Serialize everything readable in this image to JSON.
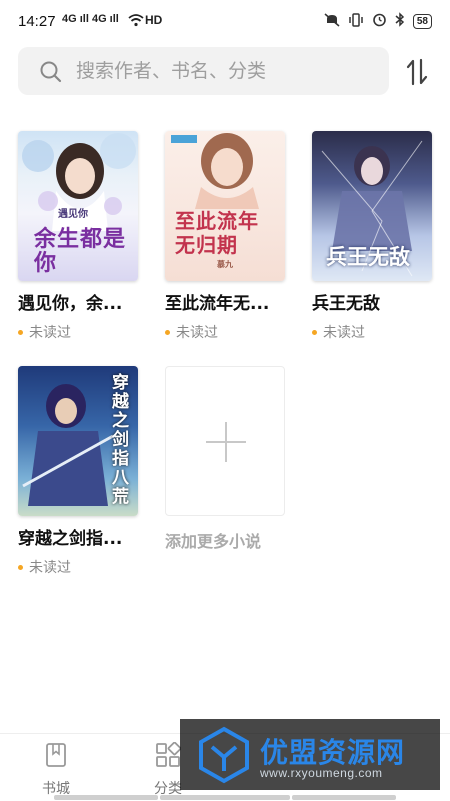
{
  "statusbar": {
    "time": "14:27",
    "signal_text": "4G ıll 4G ıll",
    "network": "HD",
    "battery": "58"
  },
  "search": {
    "placeholder": "搜索作者、书名、分类"
  },
  "shelf": {
    "books": [
      {
        "title": "遇见你，余...",
        "status": "未读过",
        "cover_text": "余生都是你",
        "cover_small": "遇见你"
      },
      {
        "title": "至此流年无...",
        "status": "未读过",
        "cover_text": "至此流年无归期",
        "cover_small": "慕九"
      },
      {
        "title": "兵王无敌",
        "status": "未读过",
        "cover_text": "兵王无敌"
      },
      {
        "title": "穿越之剑指...",
        "status": "未读过",
        "cover_text": "穿越之剑指八荒"
      }
    ],
    "add_more_label": "添加更多小说"
  },
  "bottom_nav": {
    "items": [
      {
        "label": "书城",
        "icon": "bookmark-icon"
      },
      {
        "label": "分类",
        "icon": "grid-icon"
      }
    ]
  },
  "watermark": {
    "text": "优盟资源网",
    "url": "www.rxyoumeng.com"
  },
  "colors": {
    "unread_dot": "#f5a623",
    "watermark_blue": "#2a86e8",
    "search_bg": "#f2f2f2"
  }
}
